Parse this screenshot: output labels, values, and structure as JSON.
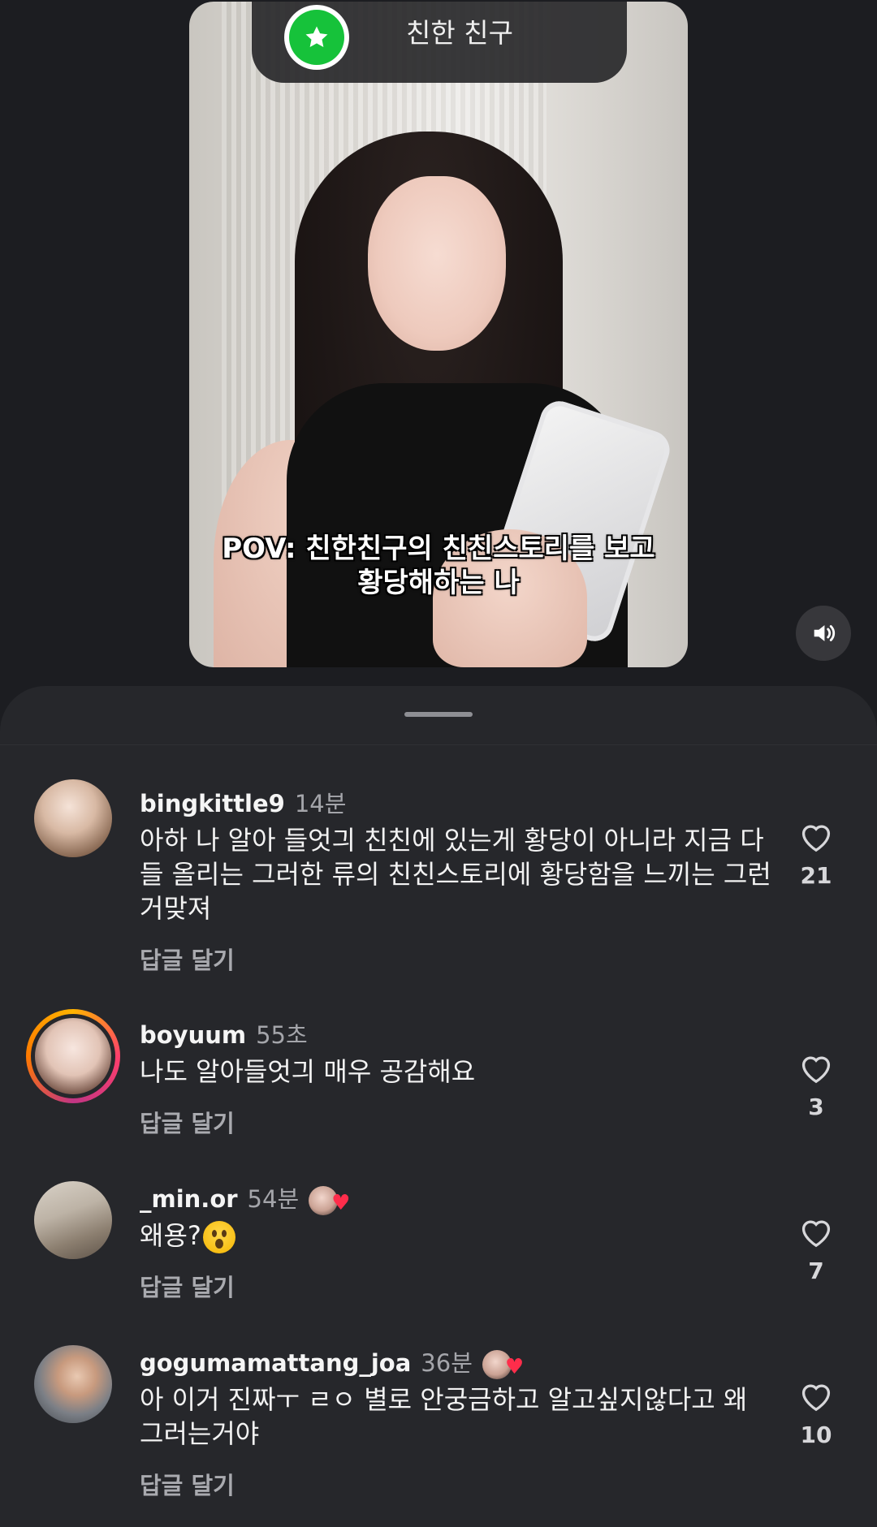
{
  "video": {
    "friends_label": "친한 친구",
    "caption_line1": "POV: 친한친구의 친친스토리를 보고",
    "caption_line2": "황당해하는 나"
  },
  "comments": [
    {
      "username": "bingkittle9",
      "time": "14분",
      "text": "아하 나 알아 들엇긔 친친에 있는게 황당이 아니라 지금 다들 올리는 그러한 류의 친친스토리에 황당함을 느끼는 그런거맞져",
      "reply": "답글 달기",
      "likes": "21"
    },
    {
      "username": "boyuum",
      "time": "55초",
      "text": "나도 알아들엇긔 매우 공감해요",
      "reply": "답글 달기",
      "likes": "3"
    },
    {
      "username": "_min.or",
      "time": "54분",
      "text": "왜용?",
      "reply": "답글 달기",
      "likes": "7"
    },
    {
      "username": "gogumamattang_joa",
      "time": "36분",
      "text": "아 이거 진짜ㅜ ㄹㅇ 별로 안궁금하고 알고싶지않다고 왜 그러는거야",
      "reply": "답글 달기",
      "likes": "10"
    }
  ],
  "colors": {
    "background": "#1c1d21",
    "sheet": "#26272b",
    "close_friends_green": "#16c23a",
    "heart_red": "#ff2d4b"
  }
}
